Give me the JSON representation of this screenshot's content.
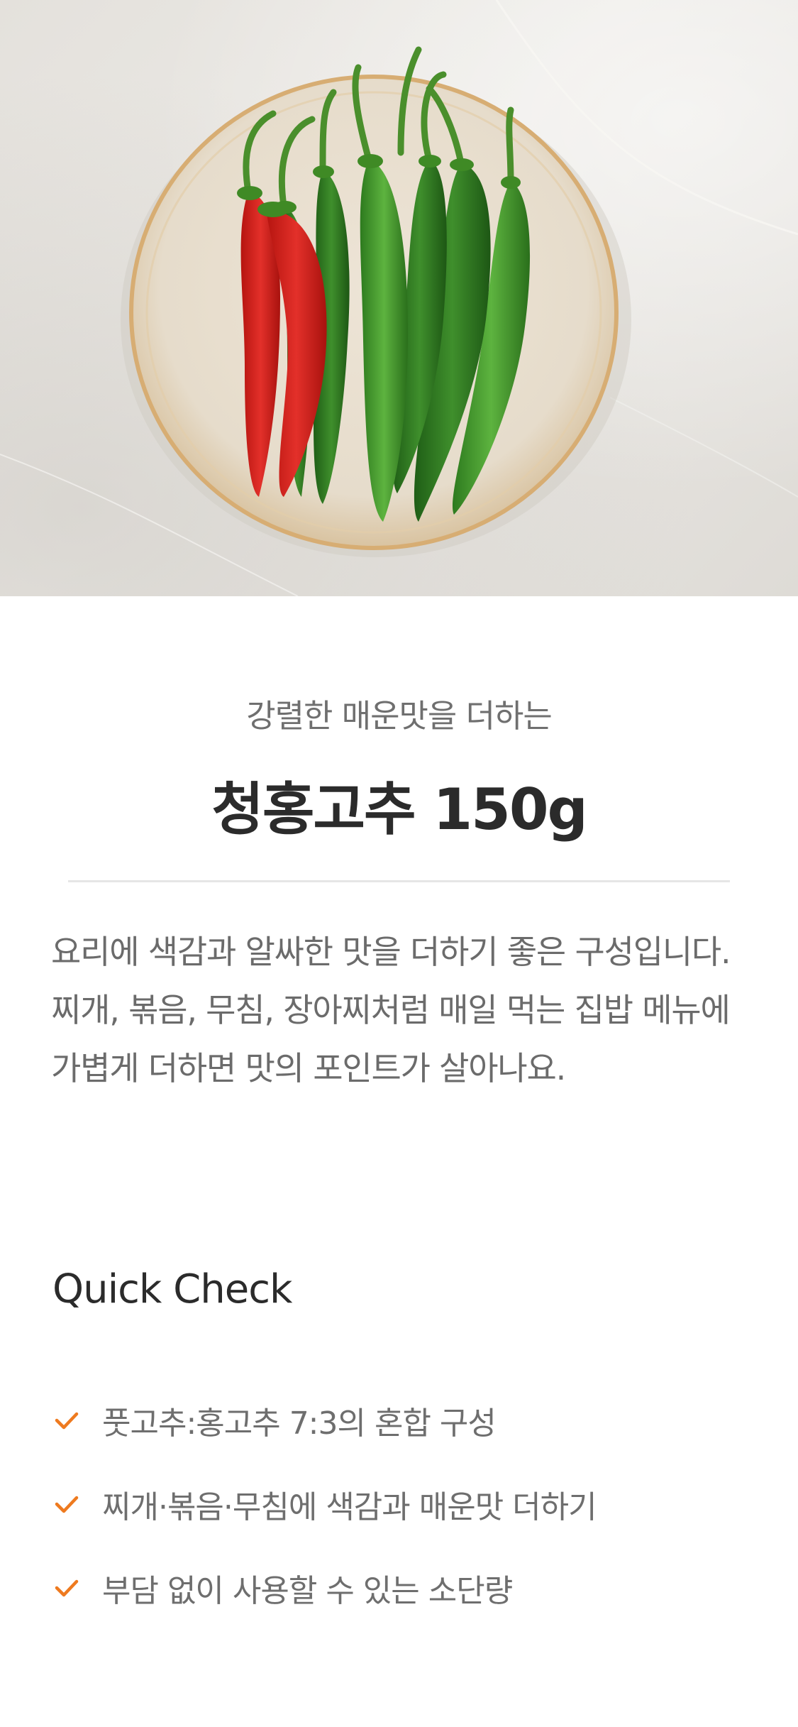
{
  "hero": {
    "image_icon": "chili-peppers-on-plate-photo",
    "colors": {
      "red_pepper": "#d4231b",
      "green_pepper": "#3f9a2c",
      "plate": "#e9dfcf",
      "plate_rim": "#d8b07a"
    }
  },
  "product": {
    "subtitle": "강렬한 매운맛을 더하는",
    "title": "청홍고추 150g"
  },
  "description": {
    "lines": [
      "요리에 색감과 알싸한 맛을 더하기 좋은 구성입니다.",
      "찌개, 볶음, 무침, 장아찌처럼 매일 먹는 집밥 메뉴에",
      "가볍게 더하면 맛의 포인트가 살아나요."
    ]
  },
  "quick_check": {
    "heading": "Quick Check",
    "check_icon": "checkmark-icon",
    "accent_color": "#ee7a1f",
    "items": [
      "풋고추:홍고추 7:3의 혼합 구성",
      "찌개·볶음·무침에 색감과 매운맛 더하기",
      "부담 없이 사용할 수 있는 소단량"
    ]
  }
}
